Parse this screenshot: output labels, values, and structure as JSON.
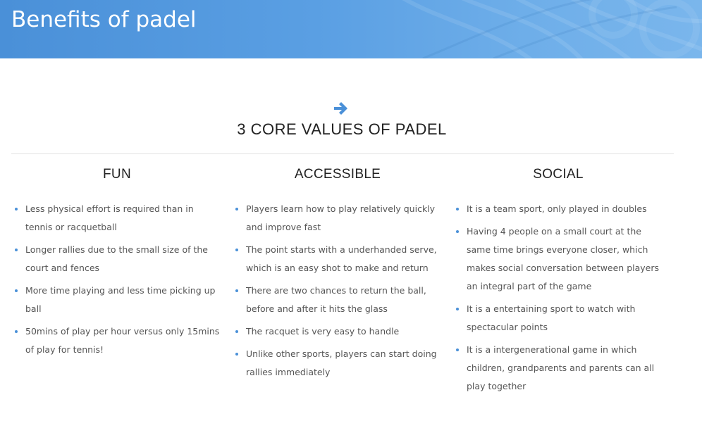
{
  "banner": {
    "title": "Benefits of padel"
  },
  "section": {
    "icon": "arrow-right-icon",
    "title": "3 CORE VALUES OF PADEL"
  },
  "colors": {
    "banner_blue": "#5a9fe3",
    "accent": "#4a90d8"
  },
  "columns": [
    {
      "title": "FUN",
      "items": [
        "Less physical effort is required than in tennis or racquetball",
        "Longer rallies due to the small size of the court and fences",
        "More time playing and less time picking up ball",
        "50mins of play per hour versus only 15mins of play for tennis!"
      ]
    },
    {
      "title": "ACCESSIBLE",
      "items": [
        "Players learn how to play relatively quickly and improve fast",
        "The point starts with a underhanded serve, which is an easy shot to make and return",
        "There are two chances to return the ball, before and after it hits the glass",
        "The racquet is very easy to handle",
        "Unlike other sports, players can start doing rallies immediately"
      ]
    },
    {
      "title": "SOCIAL",
      "items": [
        "It is a team sport, only played in doubles",
        "Having 4 people on a small court at the same time brings everyone closer, which makes social conversation between players an integral part of the game",
        "It is a entertaining sport to watch with spectacular points",
        "It is a intergenerational game in which children, grandparents and parents can all play together"
      ]
    }
  ]
}
